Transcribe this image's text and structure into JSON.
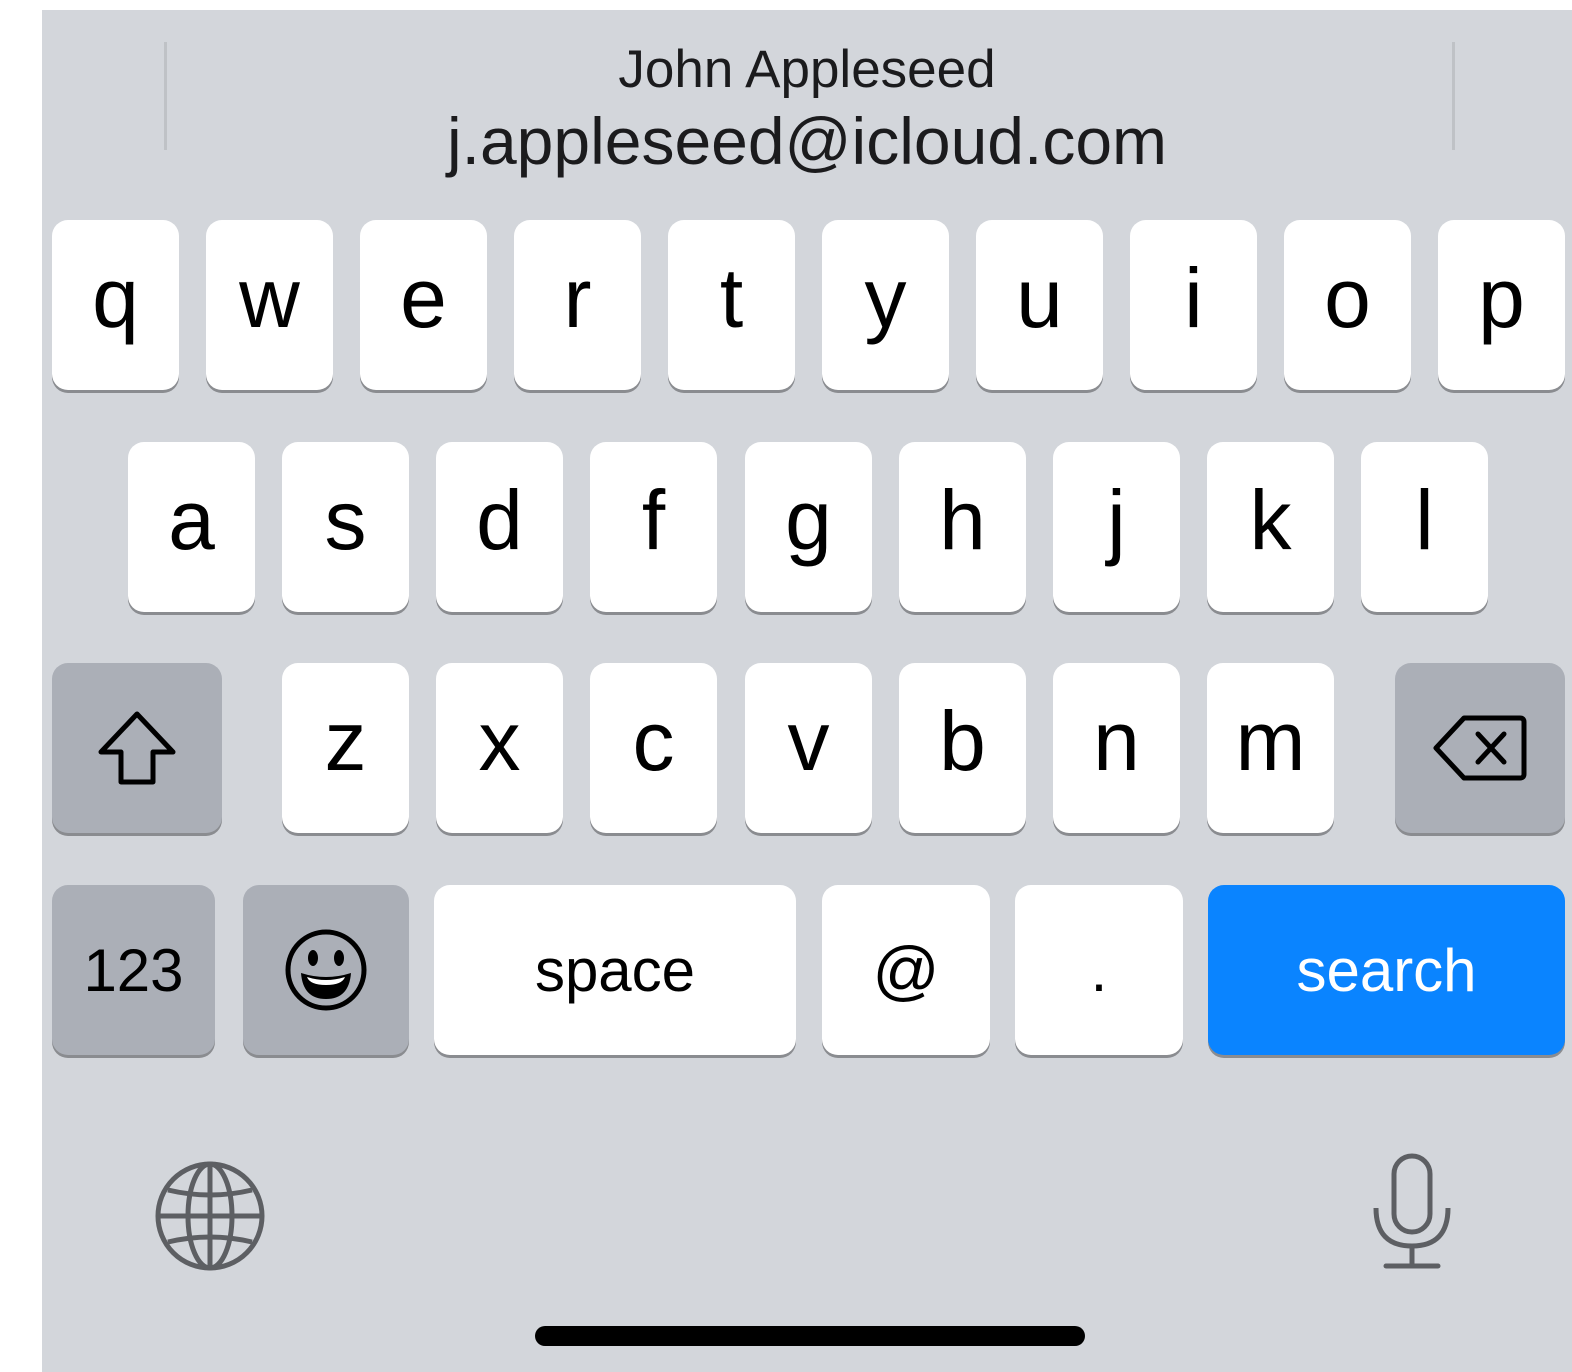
{
  "suggestion": {
    "name": "John Appleseed",
    "email": "j.appleseed@icloud.com"
  },
  "rows": {
    "row1": [
      "q",
      "w",
      "e",
      "r",
      "t",
      "y",
      "u",
      "i",
      "o",
      "p"
    ],
    "row2": [
      "a",
      "s",
      "d",
      "f",
      "g",
      "h",
      "j",
      "k",
      "l"
    ],
    "row3": [
      "z",
      "x",
      "c",
      "v",
      "b",
      "n",
      "m"
    ]
  },
  "function_keys": {
    "numbers_label": "123",
    "space_label": "space",
    "at_label": "@",
    "period_label": ".",
    "return_label": "search"
  },
  "icons": {
    "shift": "shift-arrow-icon",
    "delete": "delete-backspace-icon",
    "emoji": "emoji-smiley-icon",
    "globe": "globe-icon",
    "dictation": "microphone-icon"
  },
  "colors": {
    "keyboard_background": "#d3d6db",
    "letter_key": "#ffffff",
    "function_key": "#abafb7",
    "return_key": "#0a84ff"
  }
}
